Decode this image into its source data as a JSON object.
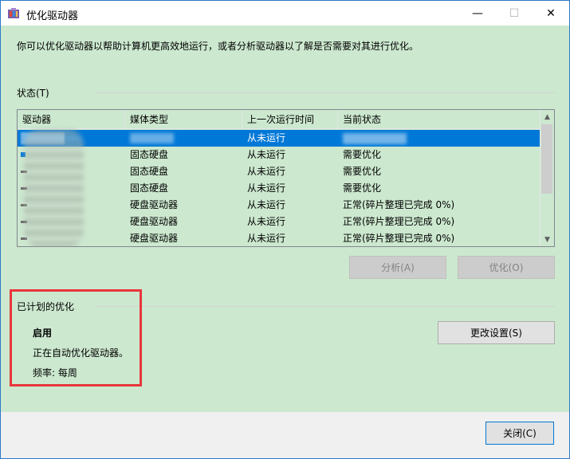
{
  "window": {
    "title": "优化驱动器",
    "minimize": "—",
    "maximize": "☐",
    "close": "✕",
    "accent": "#2b79c9"
  },
  "intro": "你可以优化驱动器以帮助计算机更高效地运行，或者分析驱动器以了解是否需要对其进行优化。",
  "status": {
    "label": "状态(T)",
    "columns": [
      "驱动器",
      "媒体类型",
      "上一次运行时间",
      "当前状态"
    ],
    "rows": [
      {
        "drive": "",
        "media": "",
        "last_run": "从未运行",
        "state": "",
        "selected": true
      },
      {
        "drive": "",
        "media": "固态硬盘",
        "last_run": "从未运行",
        "state": "需要优化"
      },
      {
        "drive": "",
        "media": "固态硬盘",
        "last_run": "从未运行",
        "state": "需要优化"
      },
      {
        "drive": "",
        "media": "固态硬盘",
        "last_run": "从未运行",
        "state": "需要优化"
      },
      {
        "drive": "",
        "media": "硬盘驱动器",
        "last_run": "从未运行",
        "state": "正常(碎片整理已完成 0%)"
      },
      {
        "drive": "",
        "media": "硬盘驱动器",
        "last_run": "从未运行",
        "state": "正常(碎片整理已完成 0%)"
      },
      {
        "drive": "",
        "media": "硬盘驱动器",
        "last_run": "从未运行",
        "state": "正常(碎片整理已完成 0%)"
      }
    ],
    "selected_color": "#0078d7"
  },
  "buttons": {
    "analyze": "分析(A)",
    "optimize": "优化(O)",
    "change_settings": "更改设置(S)",
    "close": "关闭(C)"
  },
  "schedule": {
    "title": "已计划的优化",
    "enabled": "启用",
    "description": "正在自动优化驱动器。",
    "frequency": "频率: 每周"
  },
  "colors": {
    "background": "#cce8cf",
    "footer": "#f0f0f0",
    "highlight_box": "#e8363b"
  }
}
